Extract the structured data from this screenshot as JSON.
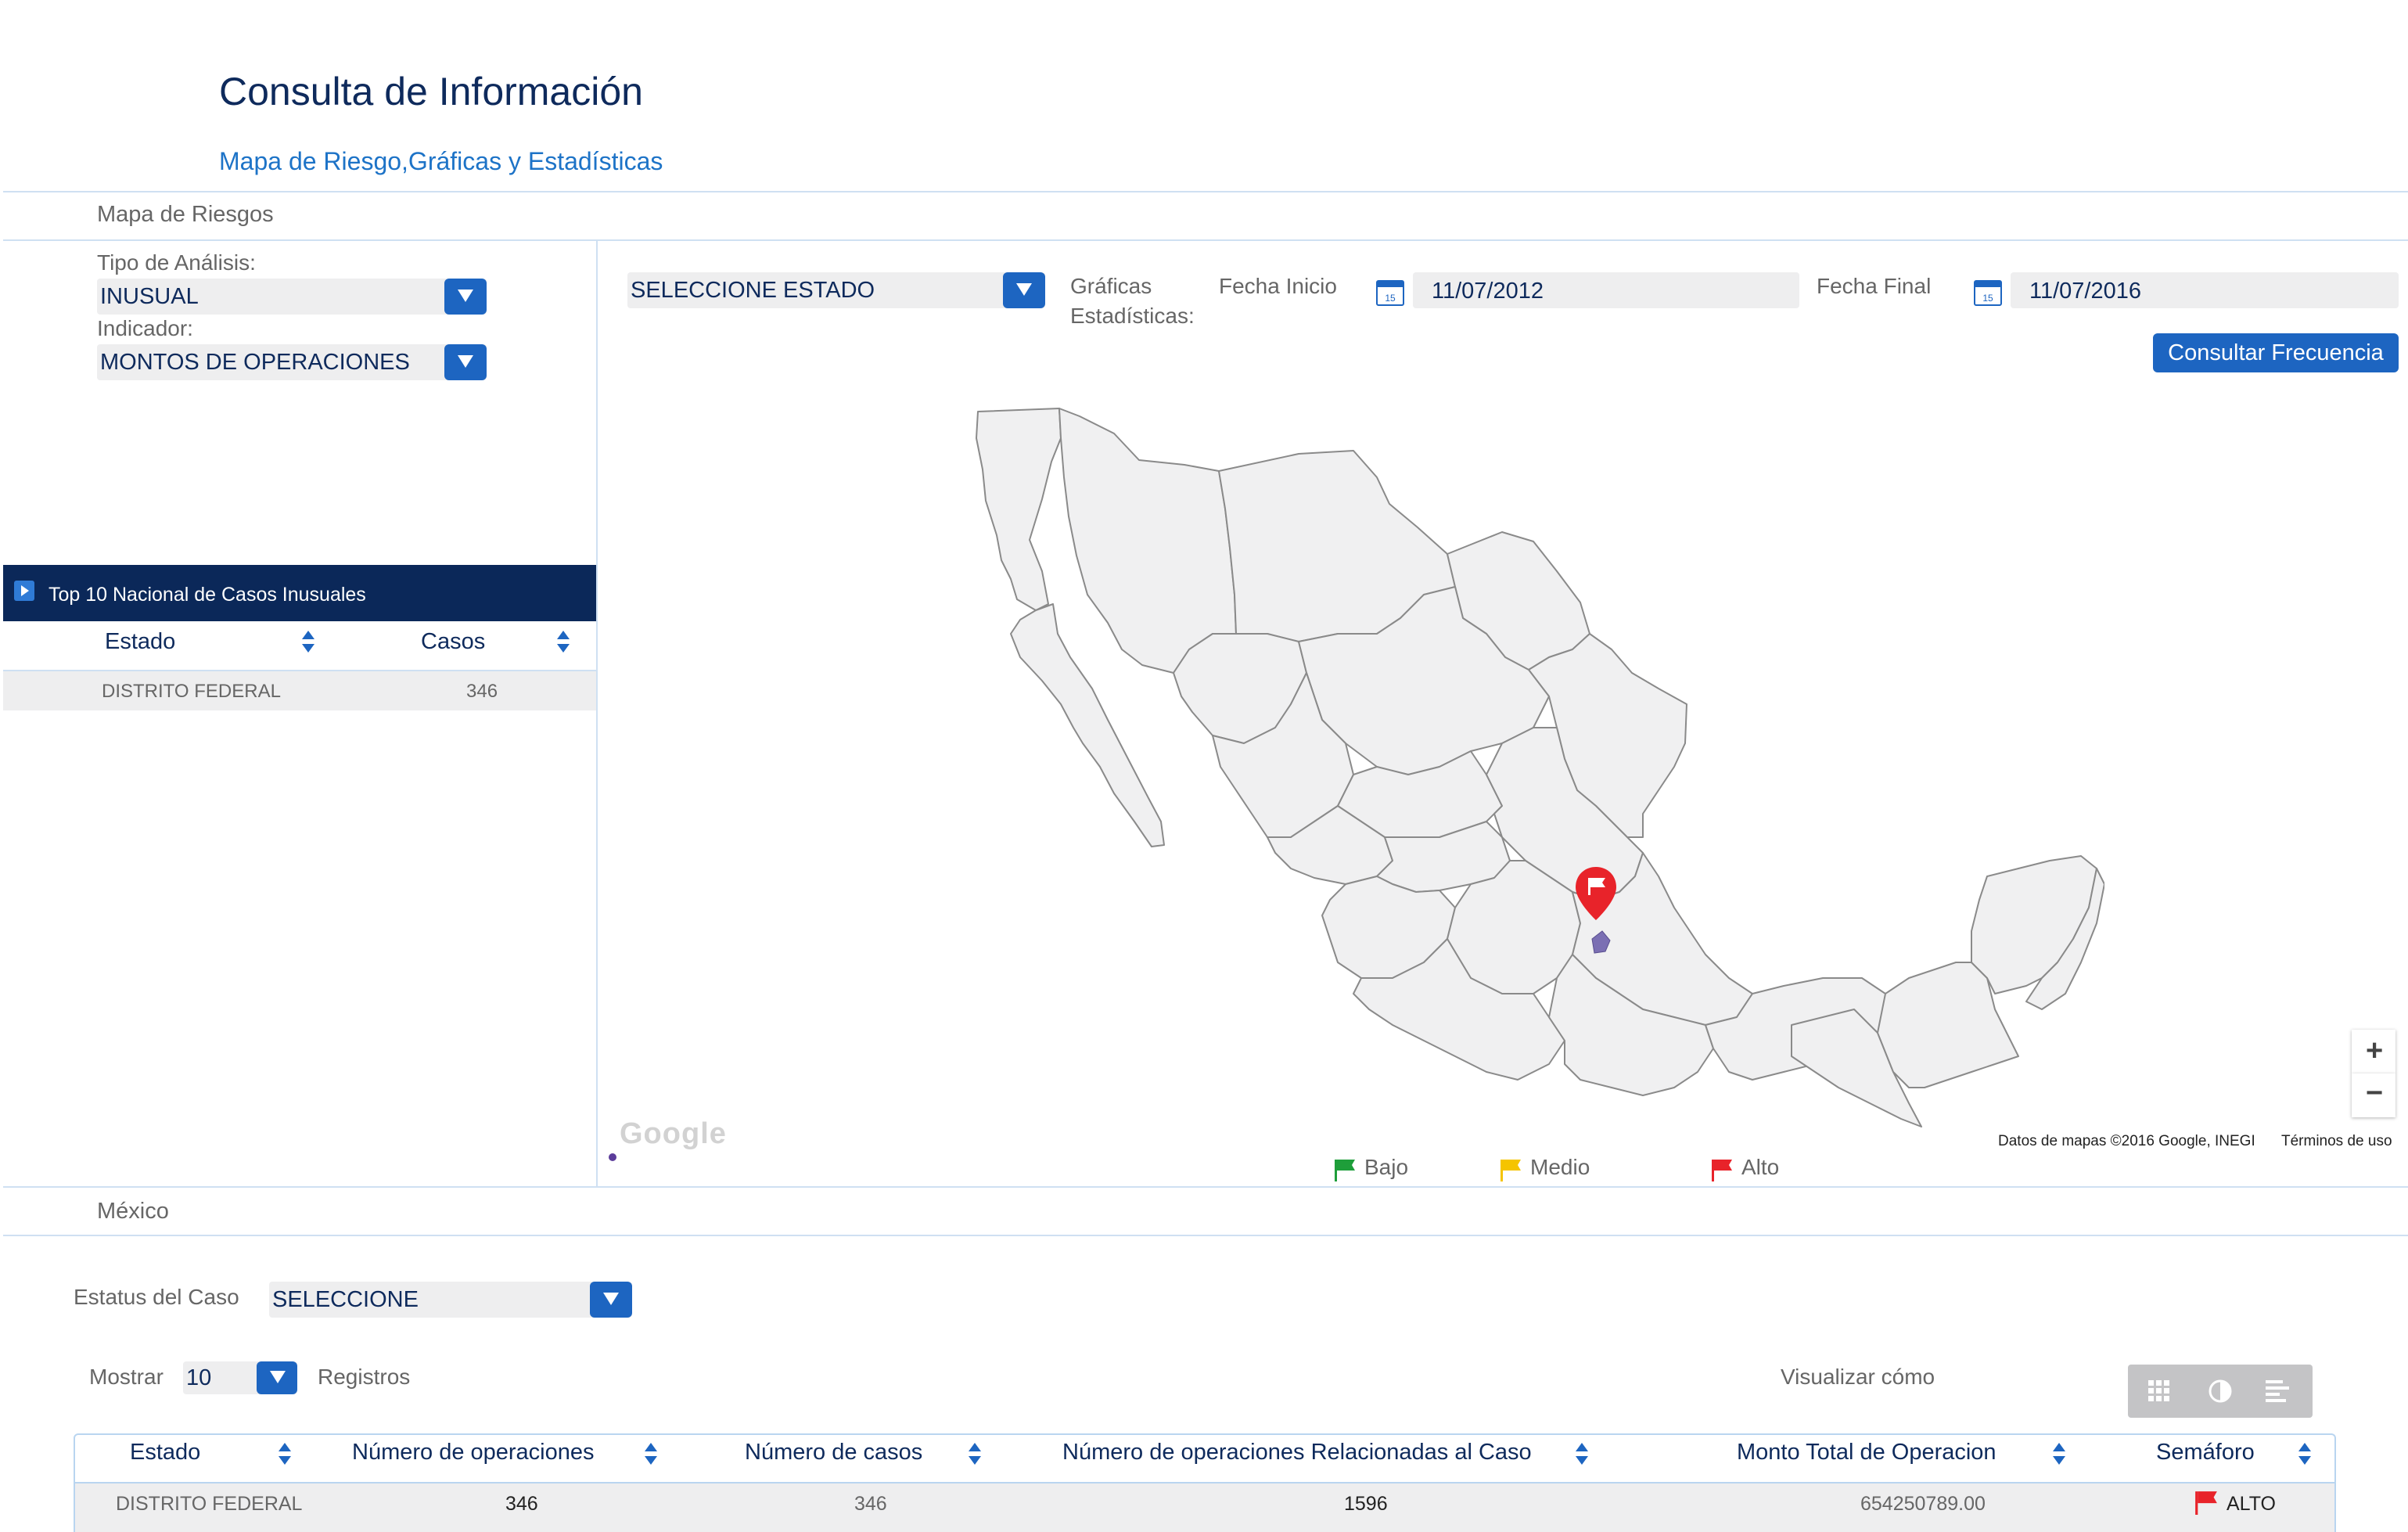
{
  "header": {
    "title": "Consulta de Información",
    "subtitle": "Mapa de Riesgo,Gráficas y Estadísticas"
  },
  "section_map": {
    "label": "Mapa de Riesgos"
  },
  "filters": {
    "tipo_label": "Tipo de Análisis:",
    "tipo_value": "INUSUAL",
    "indicador_label": "Indicador:",
    "indicador_value": "MONTOS DE OPERACIONES"
  },
  "top10": {
    "title": "Top 10 Nacional de Casos Inusuales",
    "columns": [
      "Estado",
      "Casos"
    ],
    "rows": [
      {
        "estado": "DISTRITO FEDERAL",
        "casos": "346"
      }
    ]
  },
  "toolbar": {
    "estado_select": "SELECCIONE ESTADO",
    "graficas_label_1": "Gráficas",
    "graficas_label_2": "Estadísticas:",
    "fecha_inicio_label": "Fecha Inicio",
    "fecha_inicio_value": "11/07/2012",
    "fecha_final_label": "Fecha Final",
    "fecha_final_value": "11/07/2016",
    "calendar_day": "15",
    "consultar_button": "Consultar Frecuencia"
  },
  "map": {
    "google_logo": "Google",
    "attribution": "Datos de mapas ©2016 Google, INEGI",
    "terms": "Términos de uso",
    "zoom_in": "+",
    "zoom_out": "−",
    "legend": [
      {
        "label": "Bajo",
        "color": "#1e9e3a"
      },
      {
        "label": "Medio",
        "color": "#f5c400"
      },
      {
        "label": "Alto",
        "color": "#e8232a"
      }
    ]
  },
  "section_mexico": {
    "label": "México"
  },
  "case_filter": {
    "estatus_label": "Estatus del Caso",
    "estatus_value": "SELECCIONE",
    "mostrar_label": "Mostrar",
    "mostrar_value": "10",
    "registros_label": "Registros",
    "visualizar_label": "Visualizar cómo"
  },
  "table": {
    "columns": [
      "Estado",
      "Número de operaciones",
      "Número de casos",
      "Número de operaciones Relacionadas al Caso",
      "Monto Total de Operacion",
      "Semáforo"
    ],
    "rows": [
      {
        "estado": "DISTRITO FEDERAL",
        "num_operaciones": "346",
        "num_casos": "346",
        "num_ops_relacionadas": "1596",
        "monto_total": "654250789.00",
        "semaforo": "ALTO"
      }
    ]
  },
  "colors": {
    "accent": "#1d65c1",
    "navy": "#0b2859",
    "link": "#1d73c7",
    "alert": "#e8232a"
  }
}
